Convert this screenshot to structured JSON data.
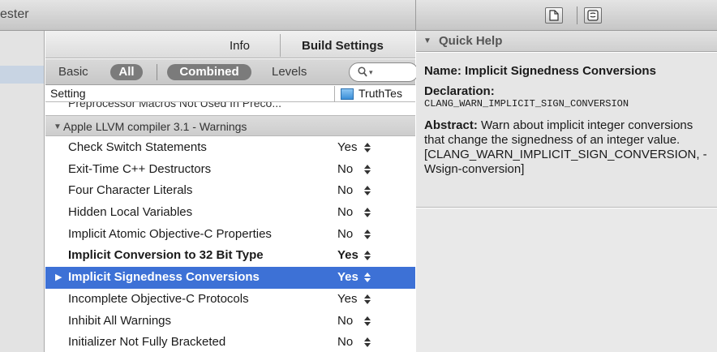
{
  "window": {
    "title": "ester"
  },
  "toolbar": {
    "file_inspector_icon": "document-icon",
    "quick_help_icon": "quick-help-icon"
  },
  "editor": {
    "tabs": [
      {
        "label": "Info"
      },
      {
        "label": "Build Settings",
        "active": true
      }
    ],
    "filter": {
      "basic": "Basic",
      "all": "All",
      "combined": "Combined",
      "levels": "Levels",
      "search_placeholder": "",
      "search_scope": "▾"
    },
    "columns": {
      "setting": "Setting",
      "target": "TruthTes"
    },
    "cut_row": "Preprocessor Macros Not Used In Preco...",
    "group": {
      "label": "Apple LLVM compiler 3.1 - Warnings"
    },
    "rows": [
      {
        "name": "Check Switch Statements",
        "value": "Yes"
      },
      {
        "name": "Exit-Time C++ Destructors",
        "value": "No"
      },
      {
        "name": "Four Character Literals",
        "value": "No"
      },
      {
        "name": "Hidden Local Variables",
        "value": "No"
      },
      {
        "name": "Implicit Atomic Objective-C Properties",
        "value": "No"
      },
      {
        "name": "Implicit Conversion to 32 Bit Type",
        "value": "Yes"
      },
      {
        "name": "Implicit Signedness Conversions",
        "value": "Yes"
      },
      {
        "name": "Incomplete Objective-C Protocols",
        "value": "Yes"
      },
      {
        "name": "Inhibit All Warnings",
        "value": "No"
      },
      {
        "name": "Initializer Not Fully Bracketed",
        "value": "No"
      }
    ]
  },
  "quick_help": {
    "header": "Quick Help",
    "name_label": "Name:",
    "name": "Implicit Signedness Conversions",
    "declaration_label": "Declaration:",
    "declaration": "CLANG_WARN_IMPLICIT_SIGN_CONVERSION",
    "abstract_label": "Abstract:",
    "abstract_text": "Warn about implicit integer conversions that change the signedness of an integer value.",
    "abstract_tail": "[CLANG_WARN_IMPLICIT_SIGN_CONVERSION, -Wsign-conversion]"
  },
  "colors": {
    "selection": "#3d71d6",
    "pill": "#7b7b7b"
  }
}
